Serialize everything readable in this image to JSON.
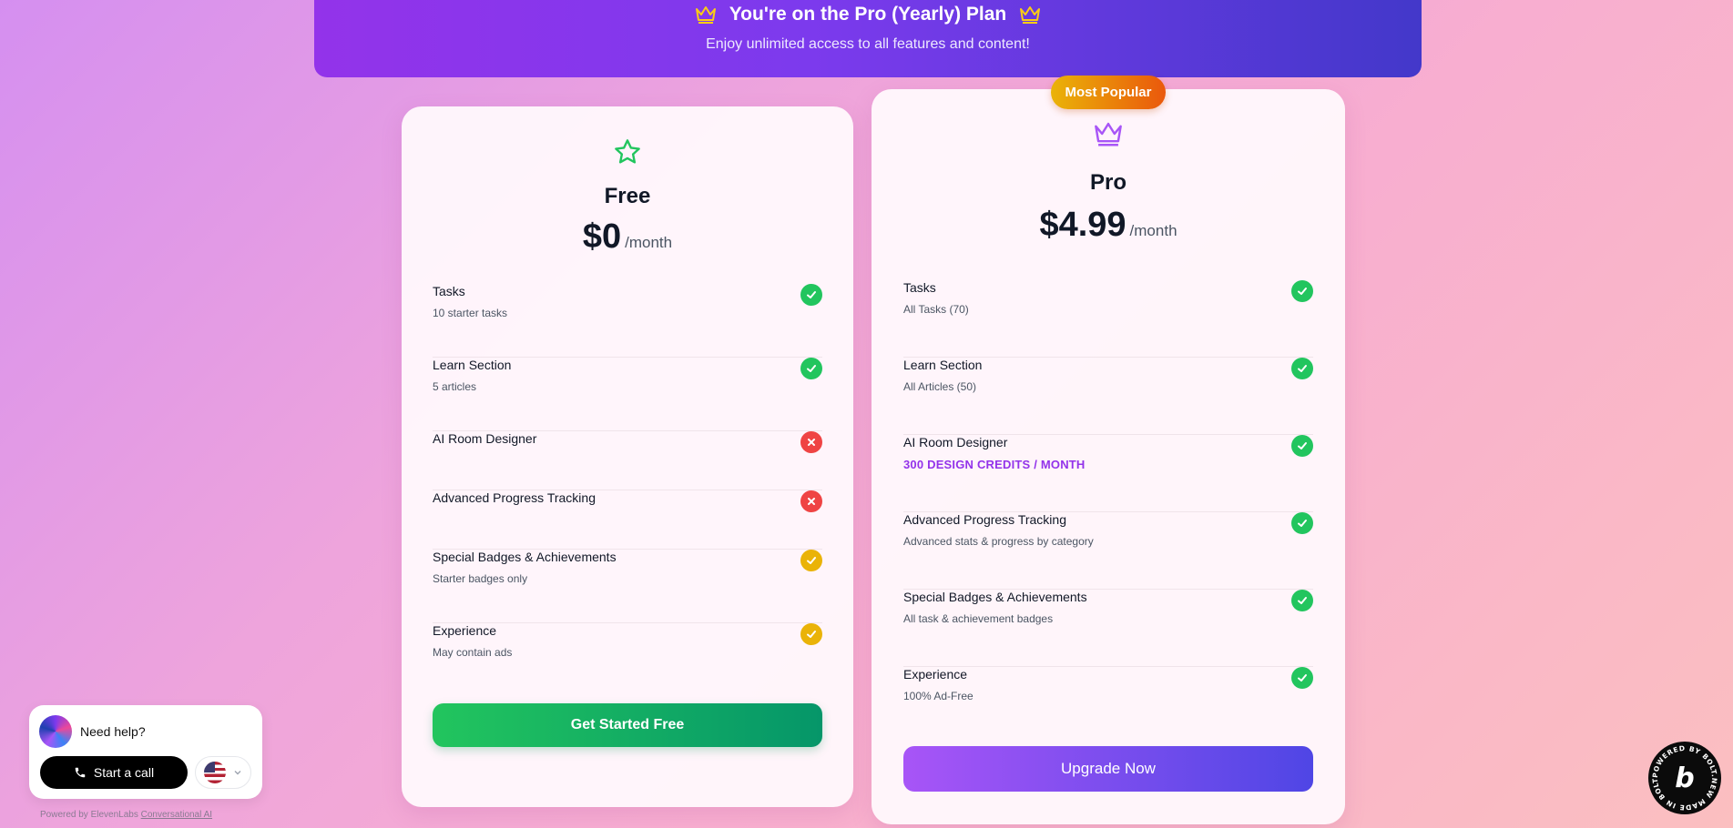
{
  "banner": {
    "title": "You're on the Pro (Yearly) Plan",
    "subtitle": "Enjoy unlimited access to all features and content!"
  },
  "plans": {
    "free": {
      "name": "Free",
      "price": "$0",
      "period": "/month",
      "icon": "star-icon",
      "features": [
        {
          "title": "Tasks",
          "sub": "10 starter tasks",
          "status": "included"
        },
        {
          "title": "Learn Section",
          "sub": "5 articles",
          "status": "included"
        },
        {
          "title": "AI Room Designer",
          "sub": "",
          "status": "excluded"
        },
        {
          "title": "Advanced Progress Tracking",
          "sub": "",
          "status": "excluded"
        },
        {
          "title": "Special Badges & Achievements",
          "sub": "Starter badges only",
          "status": "partial"
        },
        {
          "title": "Experience",
          "sub": "May contain ads",
          "status": "partial"
        }
      ],
      "cta": "Get Started Free"
    },
    "pro": {
      "badge": "Most Popular",
      "name": "Pro",
      "price": "$4.99",
      "period": "/month",
      "icon": "crown-icon",
      "features": [
        {
          "title": "Tasks",
          "sub": "All Tasks (70)",
          "status": "included"
        },
        {
          "title": "Learn Section",
          "sub": "All Articles (50)",
          "status": "included"
        },
        {
          "title": "AI Room Designer",
          "sub": "300 DESIGN CREDITS / MONTH",
          "status": "included"
        },
        {
          "title": "Advanced Progress Tracking",
          "sub": "Advanced stats & progress by category",
          "status": "included"
        },
        {
          "title": "Special Badges & Achievements",
          "sub": "All task & achievement badges",
          "status": "included"
        },
        {
          "title": "Experience",
          "sub": "100% Ad-Free",
          "status": "included"
        }
      ],
      "cta": "Upgrade Now"
    }
  },
  "help_widget": {
    "prompt": "Need help?",
    "call_label": "Start a call",
    "language": "US flag",
    "powered_by": "Powered by ElevenLabs",
    "powered_link": "Conversational AI"
  },
  "colors": {
    "included": "#22c55e",
    "excluded": "#ef4444",
    "partial": "#eab308",
    "accent": "#9333ea"
  }
}
